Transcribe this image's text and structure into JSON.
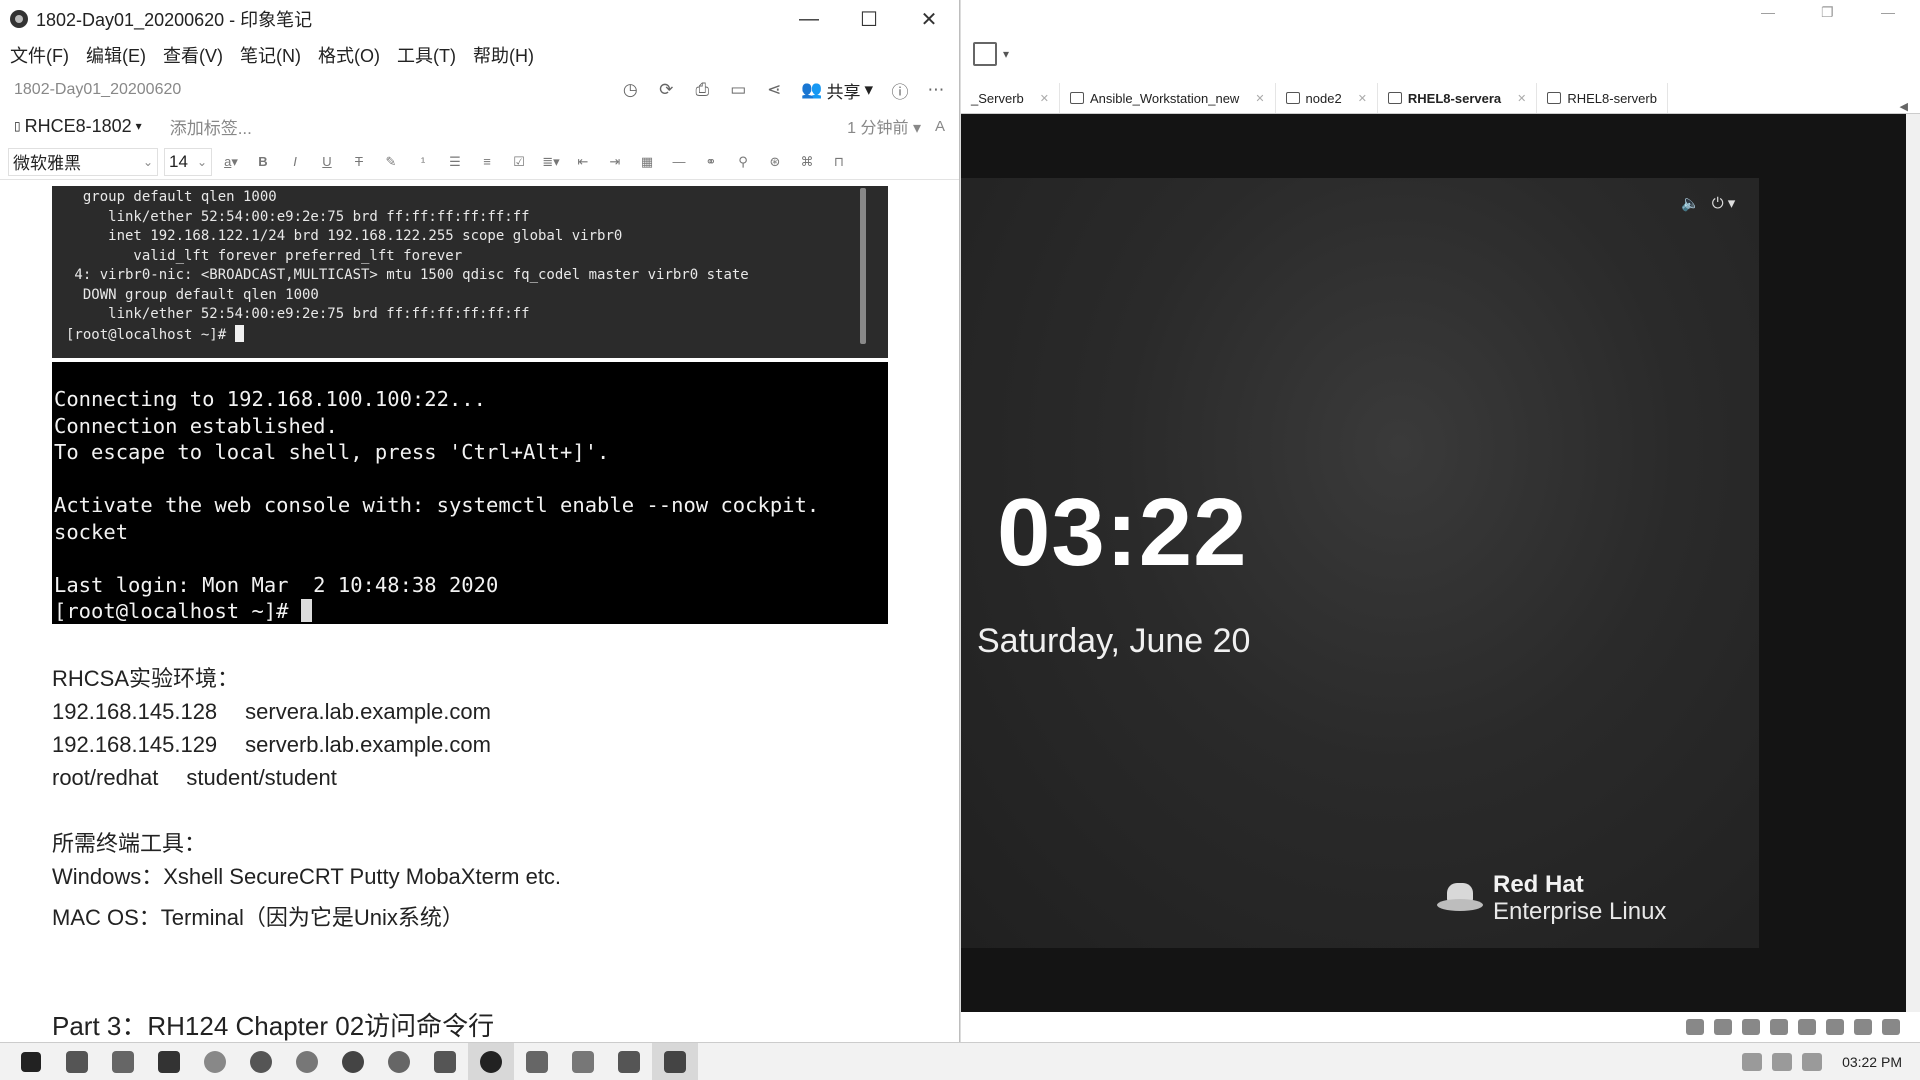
{
  "evernote": {
    "window_title": "1802-Day01_20200620 - 印象笔记",
    "controls": {
      "minimize": "—",
      "maximize": "☐",
      "close": "✕"
    },
    "menu": [
      "文件(F)",
      "编辑(E)",
      "查看(V)",
      "笔记(N)",
      "格式(O)",
      "工具(T)",
      "帮助(H)"
    ],
    "note_title": "1802-Day01_20200620",
    "share_label": "共享",
    "notebook": "RHCE8-1802",
    "add_tag": "添加标签...",
    "time_ago": "1 分钟前",
    "font_name": "微软雅黑",
    "font_size": "14",
    "terminal1": {
      "lines": [
        "  group default qlen 1000",
        "     link/ether 52:54:00:e9:2e:75 brd ff:ff:ff:ff:ff:ff",
        "     inet 192.168.122.1/24 brd 192.168.122.255 scope global virbr0",
        "        valid_lft forever preferred_lft forever",
        " 4: virbr0-nic: <BROADCAST,MULTICAST> mtu 1500 qdisc fq_codel master virbr0 state",
        "  DOWN group default qlen 1000",
        "     link/ether 52:54:00:e9:2e:75 brd ff:ff:ff:ff:ff:ff"
      ],
      "prompt": "[root@localhost ~]# "
    },
    "terminal2": {
      "lines": [
        "Connecting to 192.168.100.100:22...",
        "Connection established.",
        "To escape to local shell, press 'Ctrl+Alt+]'.",
        "",
        "Activate the web console with: systemctl enable --now cockpit.",
        "socket",
        "",
        "Last login: Mon Mar  2 10:48:38 2020"
      ],
      "prompt": "[root@localhost ~]# "
    },
    "notes": {
      "env_heading": "RHCSA实验环境：",
      "hosts": [
        {
          "ip": "192.168.145.128",
          "name": "servera.lab.example.com"
        },
        {
          "ip": "192.168.145.129",
          "name": "serverb.lab.example.com"
        }
      ],
      "creds_root": "root/redhat",
      "creds_student": "student/student",
      "tools_heading": "所需终端工具：",
      "tools_windows": "Windows：Xshell SecureCRT Putty MobaXterm etc.",
      "tools_mac": "MAC OS：Terminal（因为它是Unix系统）",
      "part3": "Part 3：RH124 Chapter 02访问命令行"
    }
  },
  "vm": {
    "tabs": [
      {
        "label": "_Serverb",
        "active": false
      },
      {
        "label": "Ansible_Workstation_new",
        "active": false
      },
      {
        "label": "node2",
        "active": false
      },
      {
        "label": "RHEL8-servera",
        "active": true
      },
      {
        "label": "RHEL8-serverb",
        "active": false
      }
    ],
    "lock_time": "03:22",
    "lock_date": "Saturday, June 20",
    "brand_line1": "Red Hat",
    "brand_line2": "Enterprise Linux"
  },
  "taskbar": {
    "clock": "03:22 PM"
  }
}
